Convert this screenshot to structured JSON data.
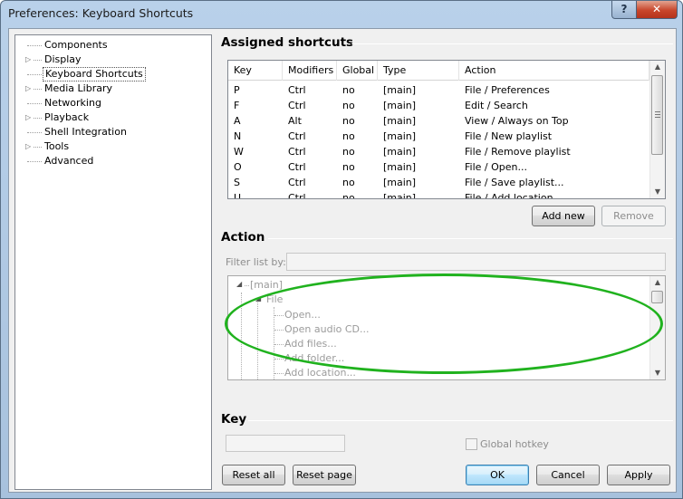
{
  "window": {
    "title": "Preferences: Keyboard Shortcuts",
    "help_glyph": "?",
    "close_glyph": "✕"
  },
  "tree": {
    "items": [
      {
        "label": "Components",
        "expandable": false
      },
      {
        "label": "Display",
        "expandable": true
      },
      {
        "label": "Keyboard Shortcuts",
        "expandable": false,
        "selected": true
      },
      {
        "label": "Media Library",
        "expandable": true
      },
      {
        "label": "Networking",
        "expandable": false
      },
      {
        "label": "Playback",
        "expandable": true
      },
      {
        "label": "Shell Integration",
        "expandable": false
      },
      {
        "label": "Tools",
        "expandable": true
      },
      {
        "label": "Advanced",
        "expandable": false
      }
    ]
  },
  "assigned": {
    "title": "Assigned shortcuts",
    "columns": [
      "Key",
      "Modifiers",
      "Global",
      "Type",
      "Action"
    ],
    "rows": [
      [
        "P",
        "Ctrl",
        "no",
        "[main]",
        "File / Preferences"
      ],
      [
        "F",
        "Ctrl",
        "no",
        "[main]",
        "Edit / Search"
      ],
      [
        "A",
        "Alt",
        "no",
        "[main]",
        "View / Always on Top"
      ],
      [
        "N",
        "Ctrl",
        "no",
        "[main]",
        "File / New playlist"
      ],
      [
        "W",
        "Ctrl",
        "no",
        "[main]",
        "File / Remove playlist"
      ],
      [
        "O",
        "Ctrl",
        "no",
        "[main]",
        "File / Open..."
      ],
      [
        "S",
        "Ctrl",
        "no",
        "[main]",
        "File / Save playlist..."
      ],
      [
        "U",
        "Ctrl",
        "no",
        "[main]",
        "File / Add location..."
      ]
    ],
    "add_new_label": "Add new",
    "remove_label": "Remove"
  },
  "action": {
    "title": "Action",
    "filter_label": "Filter list by:",
    "filter_value": "",
    "tree": {
      "root": "[main]",
      "group": "File",
      "items": [
        "Open...",
        "Open audio CD...",
        "Add files...",
        "Add folder...",
        "Add location..."
      ]
    }
  },
  "key": {
    "title": "Key",
    "value": "",
    "global_hotkey_label": "Global hotkey",
    "global_hotkey_checked": false
  },
  "buttons": {
    "reset_all": "Reset all",
    "reset_page": "Reset page",
    "ok": "OK",
    "cancel": "Cancel",
    "apply": "Apply"
  },
  "colors": {
    "highlight_ellipse": "#20b21e",
    "close_button": "#c8462b"
  }
}
